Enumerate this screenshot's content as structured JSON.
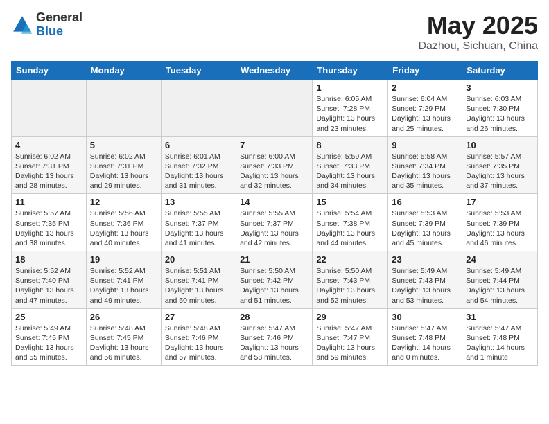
{
  "logo": {
    "general": "General",
    "blue": "Blue"
  },
  "title": {
    "month_year": "May 2025",
    "location": "Dazhou, Sichuan, China"
  },
  "headers": [
    "Sunday",
    "Monday",
    "Tuesday",
    "Wednesday",
    "Thursday",
    "Friday",
    "Saturday"
  ],
  "weeks": [
    [
      {
        "day": "",
        "info": ""
      },
      {
        "day": "",
        "info": ""
      },
      {
        "day": "",
        "info": ""
      },
      {
        "day": "",
        "info": ""
      },
      {
        "day": "1",
        "info": "Sunrise: 6:05 AM\nSunset: 7:28 PM\nDaylight: 13 hours\nand 23 minutes."
      },
      {
        "day": "2",
        "info": "Sunrise: 6:04 AM\nSunset: 7:29 PM\nDaylight: 13 hours\nand 25 minutes."
      },
      {
        "day": "3",
        "info": "Sunrise: 6:03 AM\nSunset: 7:30 PM\nDaylight: 13 hours\nand 26 minutes."
      }
    ],
    [
      {
        "day": "4",
        "info": "Sunrise: 6:02 AM\nSunset: 7:31 PM\nDaylight: 13 hours\nand 28 minutes."
      },
      {
        "day": "5",
        "info": "Sunrise: 6:02 AM\nSunset: 7:31 PM\nDaylight: 13 hours\nand 29 minutes."
      },
      {
        "day": "6",
        "info": "Sunrise: 6:01 AM\nSunset: 7:32 PM\nDaylight: 13 hours\nand 31 minutes."
      },
      {
        "day": "7",
        "info": "Sunrise: 6:00 AM\nSunset: 7:33 PM\nDaylight: 13 hours\nand 32 minutes."
      },
      {
        "day": "8",
        "info": "Sunrise: 5:59 AM\nSunset: 7:33 PM\nDaylight: 13 hours\nand 34 minutes."
      },
      {
        "day": "9",
        "info": "Sunrise: 5:58 AM\nSunset: 7:34 PM\nDaylight: 13 hours\nand 35 minutes."
      },
      {
        "day": "10",
        "info": "Sunrise: 5:57 AM\nSunset: 7:35 PM\nDaylight: 13 hours\nand 37 minutes."
      }
    ],
    [
      {
        "day": "11",
        "info": "Sunrise: 5:57 AM\nSunset: 7:35 PM\nDaylight: 13 hours\nand 38 minutes."
      },
      {
        "day": "12",
        "info": "Sunrise: 5:56 AM\nSunset: 7:36 PM\nDaylight: 13 hours\nand 40 minutes."
      },
      {
        "day": "13",
        "info": "Sunrise: 5:55 AM\nSunset: 7:37 PM\nDaylight: 13 hours\nand 41 minutes."
      },
      {
        "day": "14",
        "info": "Sunrise: 5:55 AM\nSunset: 7:37 PM\nDaylight: 13 hours\nand 42 minutes."
      },
      {
        "day": "15",
        "info": "Sunrise: 5:54 AM\nSunset: 7:38 PM\nDaylight: 13 hours\nand 44 minutes."
      },
      {
        "day": "16",
        "info": "Sunrise: 5:53 AM\nSunset: 7:39 PM\nDaylight: 13 hours\nand 45 minutes."
      },
      {
        "day": "17",
        "info": "Sunrise: 5:53 AM\nSunset: 7:39 PM\nDaylight: 13 hours\nand 46 minutes."
      }
    ],
    [
      {
        "day": "18",
        "info": "Sunrise: 5:52 AM\nSunset: 7:40 PM\nDaylight: 13 hours\nand 47 minutes."
      },
      {
        "day": "19",
        "info": "Sunrise: 5:52 AM\nSunset: 7:41 PM\nDaylight: 13 hours\nand 49 minutes."
      },
      {
        "day": "20",
        "info": "Sunrise: 5:51 AM\nSunset: 7:41 PM\nDaylight: 13 hours\nand 50 minutes."
      },
      {
        "day": "21",
        "info": "Sunrise: 5:50 AM\nSunset: 7:42 PM\nDaylight: 13 hours\nand 51 minutes."
      },
      {
        "day": "22",
        "info": "Sunrise: 5:50 AM\nSunset: 7:43 PM\nDaylight: 13 hours\nand 52 minutes."
      },
      {
        "day": "23",
        "info": "Sunrise: 5:49 AM\nSunset: 7:43 PM\nDaylight: 13 hours\nand 53 minutes."
      },
      {
        "day": "24",
        "info": "Sunrise: 5:49 AM\nSunset: 7:44 PM\nDaylight: 13 hours\nand 54 minutes."
      }
    ],
    [
      {
        "day": "25",
        "info": "Sunrise: 5:49 AM\nSunset: 7:45 PM\nDaylight: 13 hours\nand 55 minutes."
      },
      {
        "day": "26",
        "info": "Sunrise: 5:48 AM\nSunset: 7:45 PM\nDaylight: 13 hours\nand 56 minutes."
      },
      {
        "day": "27",
        "info": "Sunrise: 5:48 AM\nSunset: 7:46 PM\nDaylight: 13 hours\nand 57 minutes."
      },
      {
        "day": "28",
        "info": "Sunrise: 5:47 AM\nSunset: 7:46 PM\nDaylight: 13 hours\nand 58 minutes."
      },
      {
        "day": "29",
        "info": "Sunrise: 5:47 AM\nSunset: 7:47 PM\nDaylight: 13 hours\nand 59 minutes."
      },
      {
        "day": "30",
        "info": "Sunrise: 5:47 AM\nSunset: 7:48 PM\nDaylight: 14 hours\nand 0 minutes."
      },
      {
        "day": "31",
        "info": "Sunrise: 5:47 AM\nSunset: 7:48 PM\nDaylight: 14 hours\nand 1 minute."
      }
    ]
  ]
}
